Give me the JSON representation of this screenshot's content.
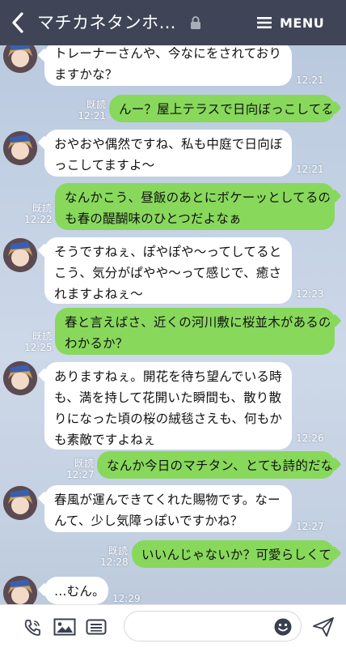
{
  "header": {
    "title": "マチカネタンホ…",
    "menu_label": "MENU"
  },
  "messages": [
    {
      "side": "left",
      "text": "トレーナーさんや、今なにをされており\nますかな？",
      "time": "12:21"
    },
    {
      "side": "right",
      "text": "んー？屋上テラスで日向ぼっこしてる",
      "read": "既読",
      "time": "12:21"
    },
    {
      "side": "left",
      "text": "おやおや偶然ですね、私も中庭で日向ぼ\nっこしてますよ〜",
      "time": "12:21"
    },
    {
      "side": "right",
      "text": "なんかこう、昼飯のあとにボケーッとしてるの\nも春の醍醐味のひとつだよなぁ",
      "read": "既読",
      "time": "12:22"
    },
    {
      "side": "left",
      "text": "そうですねぇ、ぽやぽや〜ってしてると\nこう、気分がぱやや〜って感じで、癒さ\nれますよねぇ〜",
      "time": "12:23"
    },
    {
      "side": "right",
      "text": "春と言えばさ、近くの河川敷に桜並木があるの\nわかるか？",
      "read": "既読",
      "time": "12:25"
    },
    {
      "side": "left",
      "text": "ありますねぇ。開花を待ち望んでいる時\nも、満を持して花開いた瞬間も、散り散\nりになった頃の桜の絨毯さえも、何もか\nも素敵ですよねぇ",
      "time": "12:26"
    },
    {
      "side": "right",
      "text": "なんか今日のマチタン、とても詩的だな",
      "read": "既読",
      "time": "12:27"
    },
    {
      "side": "left",
      "text": "春風が運んできてくれた賜物です。なー\nんて、少し気障っぽいですかね？",
      "time": "12:27"
    },
    {
      "side": "right",
      "text": "いいんじゃないか？可愛らしくて",
      "read": "既読",
      "time": "12:28"
    },
    {
      "side": "left",
      "text": "…むん。",
      "time": "12:29"
    }
  ],
  "footer": {
    "input_value": "",
    "icons": [
      "phone-icon",
      "image-icon",
      "keyboard-menu-icon",
      "emoji-icon",
      "send-icon"
    ]
  },
  "colors": {
    "header_bg": "#3f4556",
    "bubble_left": "#ffffff",
    "bubble_right": "#88d85c",
    "chat_bg": "#c3d1e4"
  }
}
